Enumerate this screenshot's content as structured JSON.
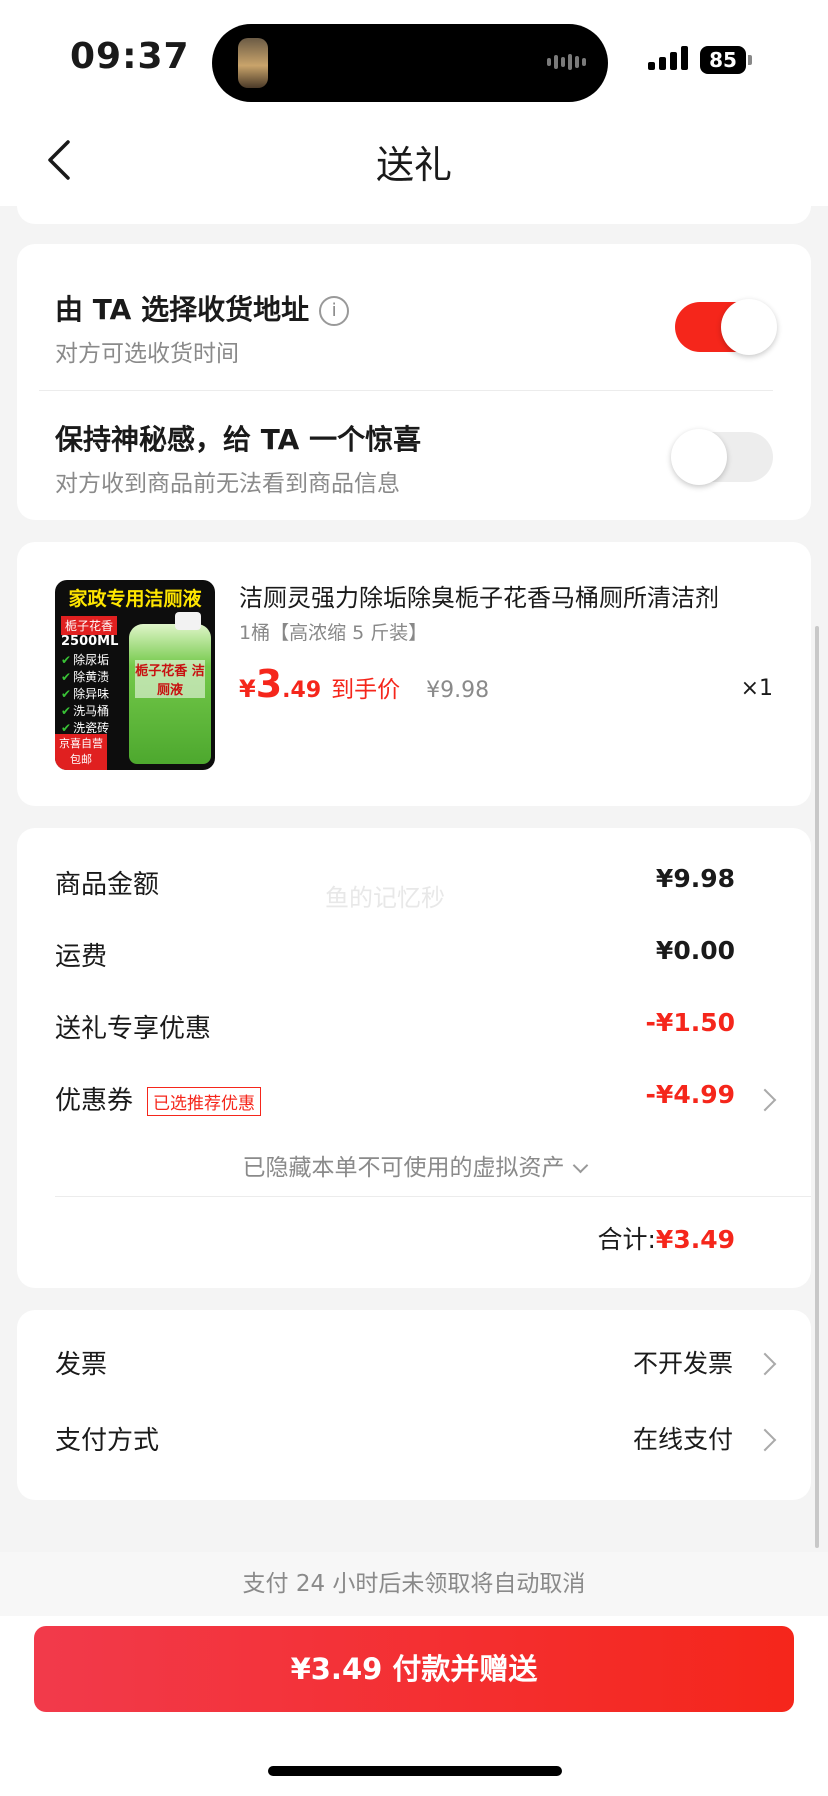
{
  "status_bar": {
    "time": "09:37",
    "battery": "85"
  },
  "nav": {
    "title": "送礼"
  },
  "options": {
    "address": {
      "title": "由 TA 选择收货地址",
      "subtitle": "对方可选收货时间",
      "enabled": true,
      "info_icon": "i"
    },
    "surprise": {
      "title": "保持神秘感，给 TA 一个惊喜",
      "subtitle": "对方收到商品前无法看到商品信息",
      "enabled": false
    }
  },
  "product": {
    "image": {
      "headline": "家政专用洁厕液",
      "tag": "栀子花香",
      "volume": "2500ML",
      "features": [
        "除尿垢",
        "除黄渍",
        "除异味",
        "洗马桶",
        "洗瓷砖"
      ],
      "jug_label": "栀子花香 洁厕液",
      "badge": "京喜自营 包邮"
    },
    "title": "洁厕灵强力除垢除臭栀子花香马桶厕所清洁剂",
    "spec": "1桶【高浓缩 5 斤装】",
    "price_yen": "¥",
    "price_int": "3",
    "price_dec": ".49",
    "price_label": "到手价",
    "original_price": "¥9.98",
    "quantity": "×1"
  },
  "summary": {
    "watermark": "鱼的记忆秒",
    "rows": [
      {
        "label": "商品金额",
        "value": "¥9.98"
      },
      {
        "label": "运费",
        "value": "¥0.00"
      },
      {
        "label": "送礼专享优惠",
        "value": "-¥1.50"
      },
      {
        "label": "优惠券",
        "tag": "已选推荐优惠",
        "value": "-¥4.99"
      }
    ],
    "hidden_assets": "已隐藏本单不可使用的虚拟资产",
    "total_label": "合计:",
    "total_value": "¥3.49"
  },
  "settings": [
    {
      "label": "发票",
      "value": "不开发票"
    },
    {
      "label": "支付方式",
      "value": "在线支付"
    }
  ],
  "footer": {
    "note": "支付 24 小时后未领取将自动取消",
    "pay_button": "¥3.49 付款并赠送"
  },
  "colors": {
    "accent": "#f5261b",
    "background": "#f4f4f4"
  }
}
